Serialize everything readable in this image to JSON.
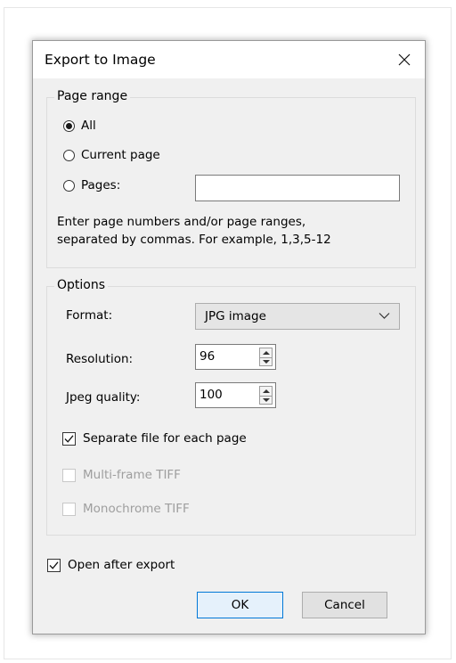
{
  "dialog": {
    "title": "Export to Image",
    "close_icon": "close-x-icon"
  },
  "page_range": {
    "legend": "Page range",
    "options": [
      {
        "label": "All",
        "selected": true
      },
      {
        "label": "Current page",
        "selected": false
      },
      {
        "label": "Pages:",
        "selected": false
      }
    ],
    "pages_value": "",
    "hint_line1": "Enter page numbers and/or page ranges,",
    "hint_line2": "separated by commas. For example, 1,3,5-12"
  },
  "options": {
    "legend": "Options",
    "format_label": "Format:",
    "format_value": "JPG image",
    "resolution_label": "Resolution:",
    "resolution_value": "96",
    "jpeg_quality_label": "Jpeg quality:",
    "jpeg_quality_value": "100",
    "separate_file_label": "Separate file for each page",
    "separate_file_checked": true,
    "multiframe_tiff_label": "Multi-frame TIFF",
    "multiframe_tiff_checked": false,
    "monochrome_tiff_label": "Monochrome TIFF",
    "monochrome_tiff_checked": false
  },
  "open_after_export_label": "Open after export",
  "open_after_export_checked": true,
  "buttons": {
    "ok": "OK",
    "cancel": "Cancel"
  },
  "colors": {
    "dialog_bg": "#f0f0f0",
    "ok_border": "#0078d7",
    "disabled_text": "#9e9e9e"
  }
}
